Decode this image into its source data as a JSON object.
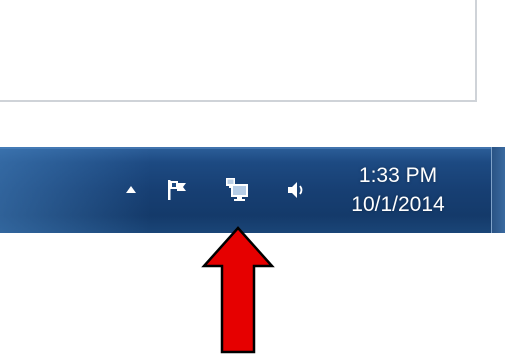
{
  "taskbar": {
    "tray_icons": [
      {
        "name": "show-hidden-icons",
        "icon": "chevron-up-icon"
      },
      {
        "name": "action-center",
        "icon": "flag-icon"
      },
      {
        "name": "network",
        "icon": "network-monitor-icon"
      },
      {
        "name": "volume",
        "icon": "speaker-icon"
      }
    ],
    "clock": {
      "time": "1:33 PM",
      "date": "10/1/2014"
    }
  },
  "annotation": {
    "arrow_color": "#e60000",
    "points_to": "network"
  },
  "colors": {
    "taskbar": "#173f73",
    "clock_text": "#ffffff",
    "window_border": "#cfd3d8"
  }
}
